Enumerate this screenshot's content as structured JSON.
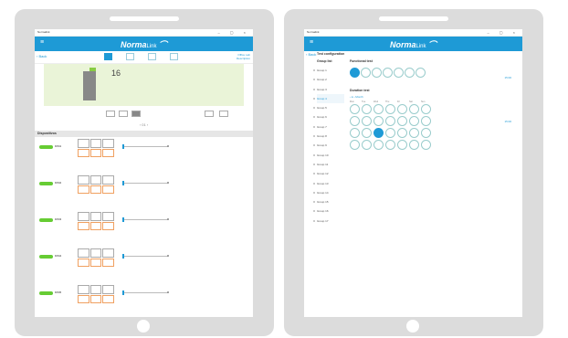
{
  "left_tablet": {
    "titlebar": "Normalink",
    "window_controls": "– ▢ ×",
    "logo_main": "Norma",
    "logo_sub": "Link",
    "back_label": "‹ Back",
    "right_text": "Office Lab",
    "right_sub": "Description",
    "temp_value": "16",
    "pager": "‹ 01 ›",
    "section_title": "Dispositivos",
    "rows": [
      "DIM1",
      "DIM2",
      "DIM3",
      "DIM4",
      "DIM5"
    ]
  },
  "right_tablet": {
    "titlebar": "Normalink",
    "window_controls": "– ▢ ×",
    "logo_main": "Norma",
    "logo_sub": "Link",
    "back_label": "‹ Back",
    "config_title": "Test configuration",
    "sidebar_head": "Group list",
    "groups": [
      "Group 1",
      "Group 2",
      "Group 3",
      "Group 4",
      "Group 5",
      "Group 6",
      "Group 7",
      "Group 8",
      "Group 9",
      "Group 10",
      "Group 11",
      "Group 12",
      "Group 13",
      "Group 14",
      "Group 15",
      "Group 16",
      "Group 17"
    ],
    "selected_group_index": 3,
    "functional_test": "Functional test",
    "duration_test": "Duration test",
    "month": "‹ ● › Month",
    "weekdays": [
      "Mon",
      "Tue",
      "Wed",
      "Thu",
      "Fri",
      "Sat",
      "Sun"
    ],
    "side_label_a": "15:00",
    "side_label_b": "15:00"
  }
}
